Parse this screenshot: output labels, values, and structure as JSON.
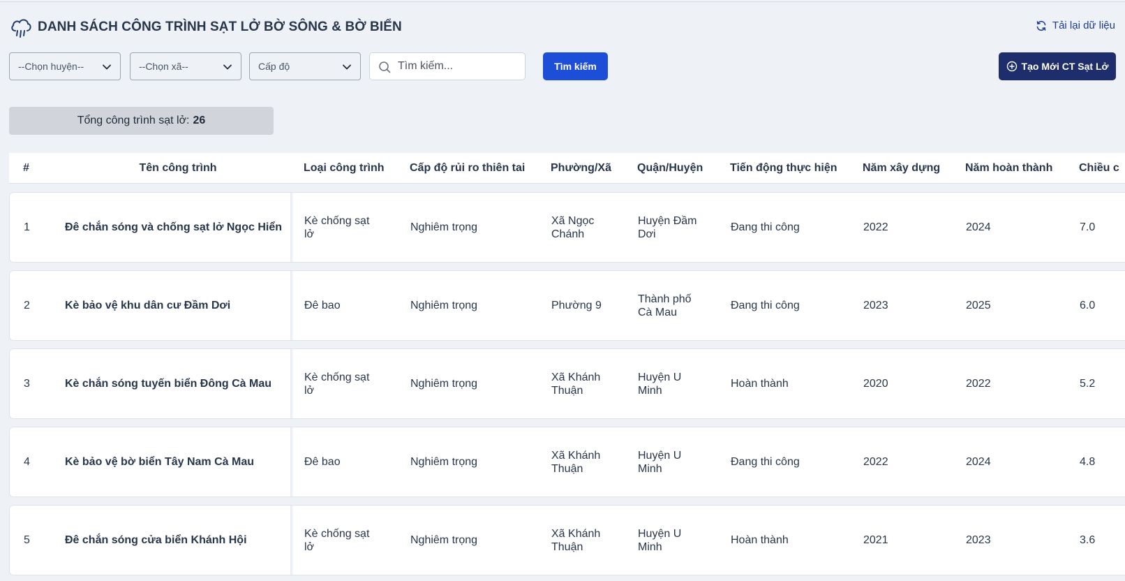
{
  "header": {
    "title": "DANH SÁCH CÔNG TRÌNH SẠT LỞ BỜ SÔNG & BỜ BIỂN",
    "reload_label": "Tải lại dữ liệu"
  },
  "filters": {
    "district_placeholder": "--Chọn huyện--",
    "commune_placeholder": "--Chọn xã--",
    "level_placeholder": "Cấp độ",
    "search_placeholder": "Tìm kiếm...",
    "search_button": "Tìm kiếm",
    "create_button": "Tạo Mới CT Sạt Lở"
  },
  "summary": {
    "label": "Tổng công trình sạt lở:",
    "count": "26"
  },
  "table": {
    "columns": [
      "#",
      "Tên công trình",
      "Loại công trình",
      "Cấp độ rủi ro thiên tai",
      "Phường/Xã",
      "Quận/Huyện",
      "Tiến động thực hiện",
      "Năm xây dựng",
      "Năm hoàn thành",
      "Chiều c"
    ],
    "rows": [
      {
        "no": "1",
        "name": "Đê chắn sóng và chống sạt lở Ngọc Hiển",
        "type_l1": "Kè chống sạt",
        "type_l2": "lở",
        "risk": "Nghiêm trọng",
        "ward_l1": "Xã Ngọc",
        "ward_l2": "Chánh",
        "district_l1": "Huyện Đầm",
        "district_l2": "Dơi",
        "progress": "Đang thi công",
        "build_year": "2022",
        "finish_year": "2024",
        "length": "7.0"
      },
      {
        "no": "2",
        "name": "Kè bảo vệ khu dân cư Đầm Dơi",
        "type_l1": "Đê bao",
        "type_l2": "",
        "risk": "Nghiêm trọng",
        "ward_l1": "Phường 9",
        "ward_l2": "",
        "district_l1": "Thành phố",
        "district_l2": "Cà Mau",
        "progress": "Đang thi công",
        "build_year": "2023",
        "finish_year": "2025",
        "length": "6.0"
      },
      {
        "no": "3",
        "name": "Kè chắn sóng tuyến biển Đông Cà Mau",
        "type_l1": "Kè chống sạt",
        "type_l2": "lở",
        "risk": "Nghiêm trọng",
        "ward_l1": "Xã Khánh",
        "ward_l2": "Thuận",
        "district_l1": "Huyện U",
        "district_l2": "Minh",
        "progress": "Hoàn thành",
        "build_year": "2020",
        "finish_year": "2022",
        "length": "5.2"
      },
      {
        "no": "4",
        "name": "Kè bảo vệ bờ biển Tây Nam Cà Mau",
        "type_l1": "Đê bao",
        "type_l2": "",
        "risk": "Nghiêm trọng",
        "ward_l1": "Xã Khánh",
        "ward_l2": "Thuận",
        "district_l1": "Huyện U",
        "district_l2": "Minh",
        "progress": "Đang thi công",
        "build_year": "2022",
        "finish_year": "2024",
        "length": "4.8"
      },
      {
        "no": "5",
        "name": "Đê chắn sóng cửa biển Khánh Hội",
        "type_l1": "Kè chống sạt",
        "type_l2": "lở",
        "risk": "Nghiêm trọng",
        "ward_l1": "Xã Khánh",
        "ward_l2": "Thuận",
        "district_l1": "Huyện U",
        "district_l2": "Minh",
        "progress": "Hoàn thành",
        "build_year": "2021",
        "finish_year": "2023",
        "length": "3.6"
      }
    ]
  },
  "colors": {
    "background": "#eef2f7",
    "primary_button": "#1d4ed8",
    "create_button": "#1e2d6b",
    "link": "#1e3a8a"
  },
  "icons": {
    "title_icon": "cloud-rain-icon",
    "reload_icon": "refresh-icon",
    "search_icon": "search-icon",
    "create_icon": "plus-circle-icon"
  }
}
